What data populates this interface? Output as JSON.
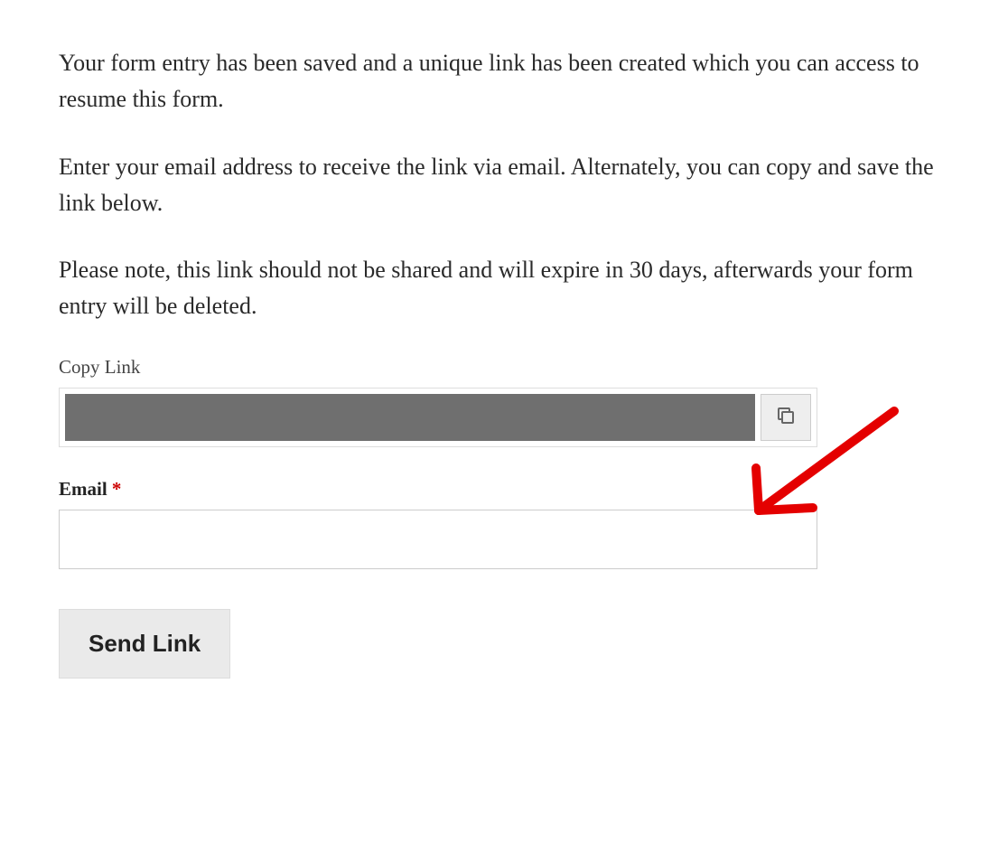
{
  "intro": {
    "p1": "Your form entry has been saved and a unique link has been created which you can access to resume this form.",
    "p2": "Enter your email address to receive the link via email. Alternately, you can copy and save the link below.",
    "p3": "Please note, this link should not be shared and will expire in 30 days, afterwards your form entry will be deleted."
  },
  "copy": {
    "label": "Copy Link",
    "value": ""
  },
  "email": {
    "label": "Email",
    "required_mark": "*",
    "value": ""
  },
  "buttons": {
    "send": "Send Link"
  }
}
